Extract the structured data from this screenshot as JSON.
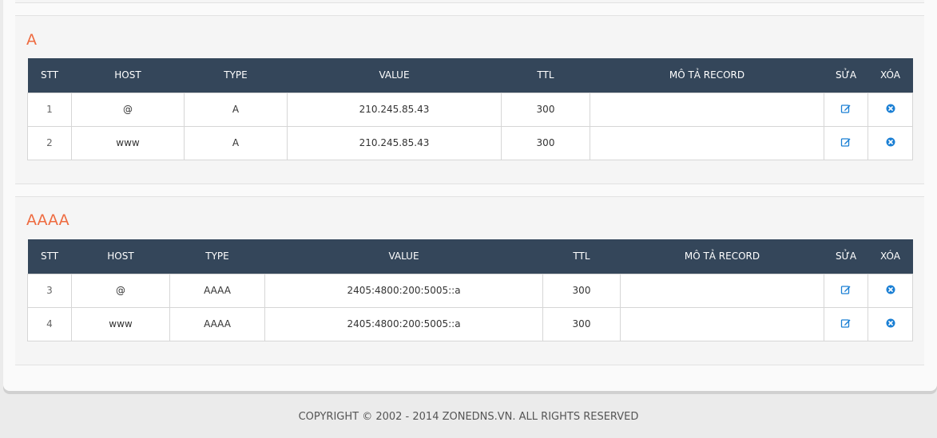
{
  "sections": [
    {
      "title": "A",
      "headers": {
        "stt": "STT",
        "host": "HOST",
        "type": "TYPE",
        "value": "VALUE",
        "ttl": "TTL",
        "desc": "MÔ TẢ RECORD",
        "edit": "SỬA",
        "delete": "XÓA"
      },
      "rows": [
        {
          "stt": "1",
          "host": "@",
          "type": "A",
          "value": "210.245.85.43",
          "ttl": "300",
          "desc": ""
        },
        {
          "stt": "2",
          "host": "www",
          "type": "A",
          "value": "210.245.85.43",
          "ttl": "300",
          "desc": ""
        }
      ]
    },
    {
      "title": "AAAA",
      "headers": {
        "stt": "STT",
        "host": "HOST",
        "type": "TYPE",
        "value": "VALUE",
        "ttl": "TTL",
        "desc": "MÔ TẢ RECORD",
        "edit": "SỬA",
        "delete": "XÓA"
      },
      "rows": [
        {
          "stt": "3",
          "host": "@",
          "type": "AAAA",
          "value": "2405:4800:200:5005::a",
          "ttl": "300",
          "desc": ""
        },
        {
          "stt": "4",
          "host": "www",
          "type": "AAAA",
          "value": "2405:4800:200:5005::a",
          "ttl": "300",
          "desc": ""
        }
      ]
    }
  ],
  "icons": {
    "edit": "edit-icon",
    "delete": "delete-circle-icon"
  },
  "colors": {
    "header_bg": "#34465a",
    "section_title": "#ee6b40",
    "icon_blue": "#1a7fd4"
  },
  "footer": {
    "copyright": "COPYRIGHT © 2002 - 2014 ZONEDNS.VN. ALL RIGHTS RESERVED"
  }
}
